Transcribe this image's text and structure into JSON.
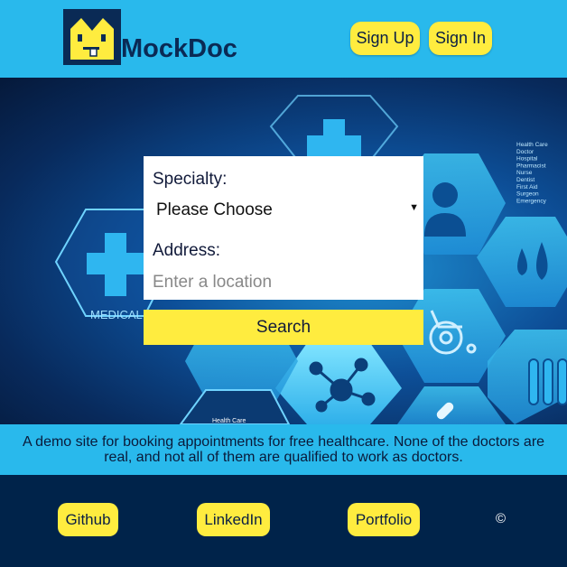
{
  "header": {
    "brand": "MockDoc",
    "signup_label": "Sign Up",
    "signin_label": "Sign In",
    "logo_icon": "mockdoc-face-logo-icon"
  },
  "hero": {
    "background_labels": {
      "medical": "MEDICAL",
      "health_care": "Health Care",
      "word_list": [
        "Health Care",
        "Doctor",
        "Hospital",
        "Pharmacist",
        "Nurse",
        "Dentist",
        "First Aid",
        "Surgeon",
        "Emergency"
      ]
    },
    "background_icons": [
      "medical-cross-icon",
      "doctor-icon",
      "drops-icon",
      "wheelchair-icon",
      "molecule-icon",
      "test-tubes-icon",
      "pill-icon"
    ]
  },
  "form": {
    "specialty_label": "Specialty:",
    "specialty_selected": "Please Choose",
    "address_label": "Address:",
    "address_placeholder": "Enter a location",
    "address_value": "",
    "search_label": "Search"
  },
  "info": {
    "text": "A demo site for booking appointments for free healthcare. None of the doctors are real, and not all of them are qualified to work as doctors."
  },
  "footer": {
    "links": [
      "Github",
      "LinkedIn",
      "Portfolio"
    ],
    "copyright": "©"
  },
  "colors": {
    "header_bg": "#29b9ec",
    "accent_yellow": "#ffec3f",
    "footer_bg": "#00234a",
    "brand_text": "#0a2a55"
  }
}
